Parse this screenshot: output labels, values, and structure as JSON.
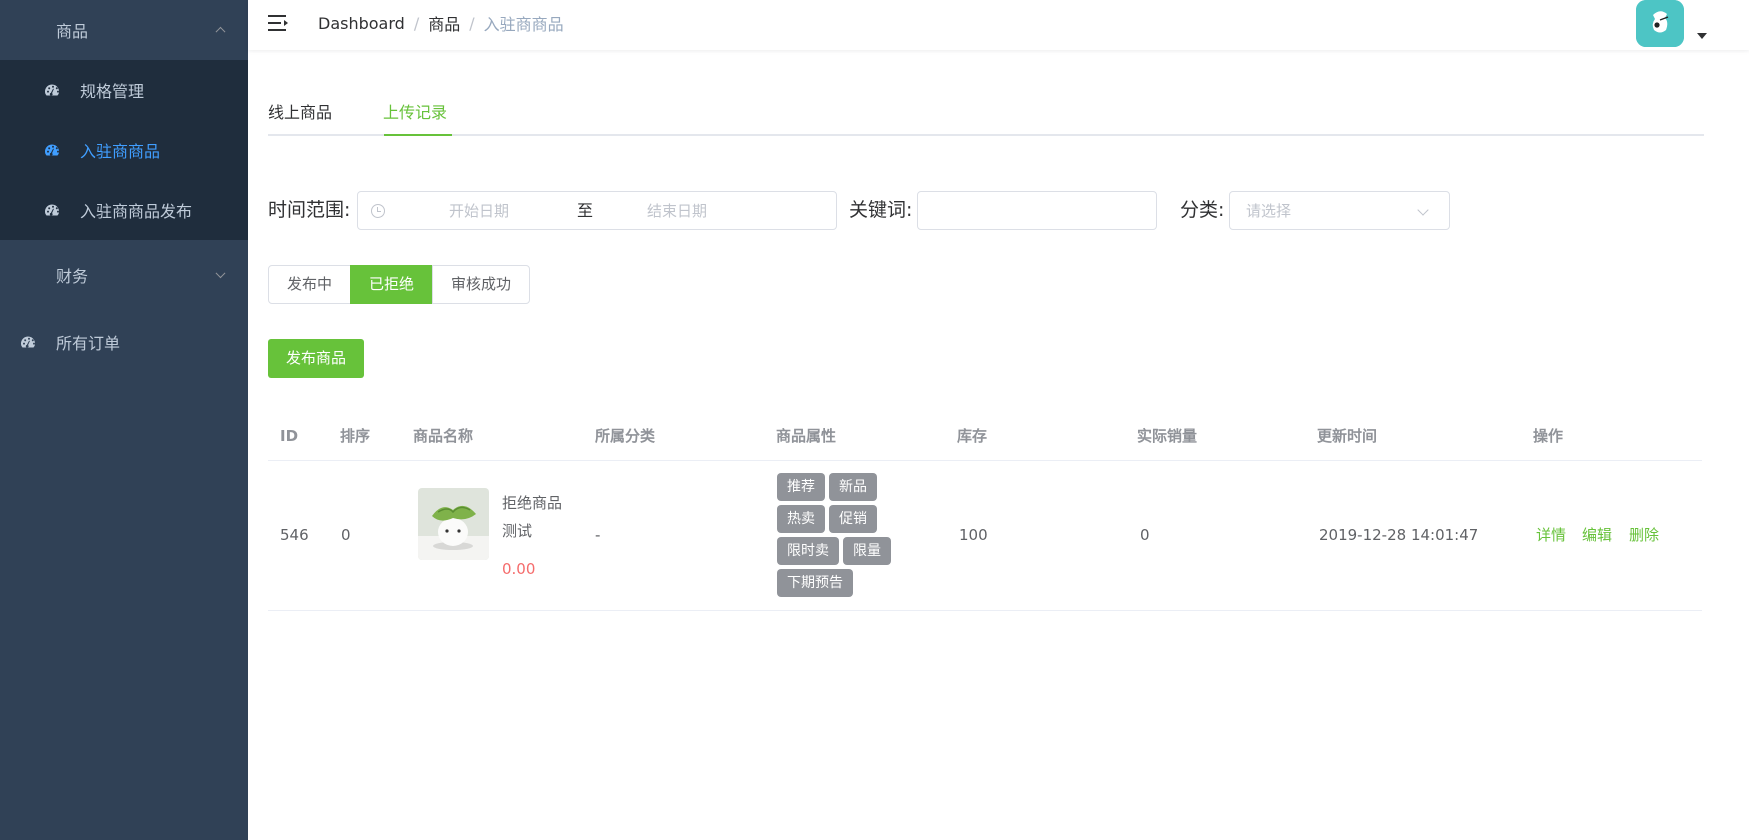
{
  "sidebar": {
    "menu_goods": "商品",
    "items": [
      {
        "label": "规格管理",
        "icon": "dashboard-icon"
      },
      {
        "label": "入驻商商品",
        "icon": "dashboard-icon"
      },
      {
        "label": "入驻商商品发布",
        "icon": "dashboard-icon"
      }
    ],
    "menu_finance": "财务",
    "all_orders": "所有订单"
  },
  "navbar": {
    "breadcrumb": [
      "Dashboard",
      "商品",
      "入驻商商品"
    ]
  },
  "tabs": [
    "线上商品",
    "上传记录"
  ],
  "filters": {
    "time_range_label": "时间范围:",
    "start_placeholder": "开始日期",
    "range_separator": "至",
    "end_placeholder": "结束日期",
    "keyword_label": "关键词:",
    "keyword_value": "",
    "category_label": "分类:",
    "category_placeholder": "请选择"
  },
  "status_buttons": [
    "发布中",
    "已拒绝",
    "审核成功"
  ],
  "publish_button": "发布商品",
  "table": {
    "headers": [
      "ID",
      "排序",
      "商品名称",
      "所属分类",
      "商品属性",
      "库存",
      "实际销量",
      "更新时间",
      "操作"
    ],
    "rows": [
      {
        "id": "546",
        "sort": "0",
        "name_line1": "拒绝商品",
        "name_line2": "测试",
        "price": "0.00",
        "category": "-",
        "tags": [
          "推荐",
          "新品",
          "热卖",
          "促销",
          "限时卖",
          "限量",
          "下期预告"
        ],
        "stock": "100",
        "sales": "0",
        "updated": "2019-12-28 14:01:47",
        "actions": [
          "详情",
          "编辑",
          "删除"
        ]
      }
    ]
  },
  "colors": {
    "sidebar_bg": "#304156",
    "submenu_bg": "#1f2d3d",
    "active_menu": "#409eff",
    "accent_green": "#67c23a",
    "price_red": "#f56c6c",
    "tag_gray": "#909399",
    "avatar_bg": "#4dc5c5"
  }
}
